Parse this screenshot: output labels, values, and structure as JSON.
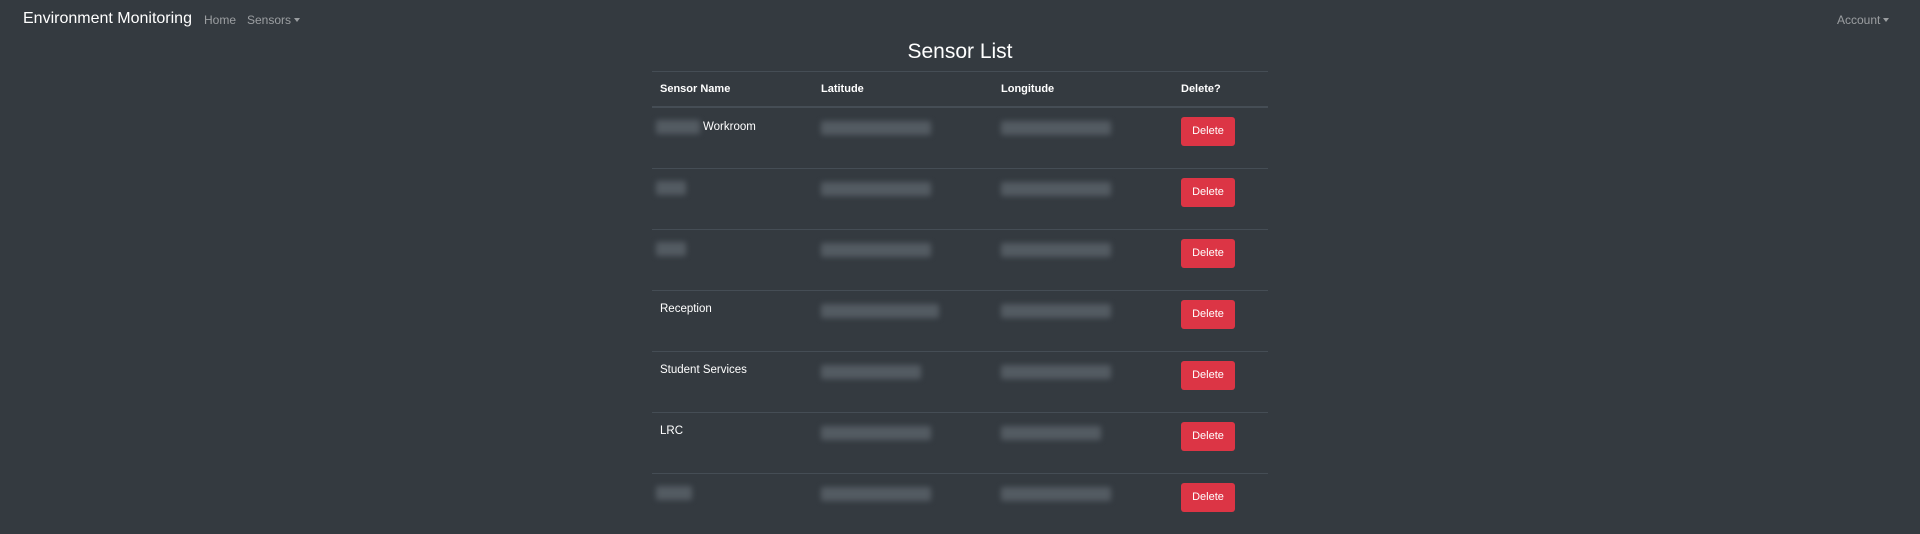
{
  "navbar": {
    "brand": "Environment Monitoring",
    "home_label": "Home",
    "sensors_label": "Sensors",
    "account_label": "Account"
  },
  "page": {
    "title": "Sensor List"
  },
  "table": {
    "headers": [
      "Sensor Name",
      "Latitude",
      "Longitude",
      "Delete?"
    ],
    "rows": [
      {
        "name": "Workroom",
        "name_redacted_prefix": true,
        "latitude_redacted": true,
        "longitude_redacted": true
      },
      {
        "name": "",
        "name_redacted_prefix": true,
        "latitude_redacted": true,
        "longitude_redacted": true
      },
      {
        "name": "",
        "name_redacted_prefix": true,
        "latitude_redacted": true,
        "longitude_redacted": true
      },
      {
        "name": "Reception",
        "name_redacted_prefix": false,
        "latitude_redacted": true,
        "longitude_redacted": true
      },
      {
        "name": "Student Services",
        "name_redacted_prefix": false,
        "latitude_redacted": true,
        "longitude_redacted": true
      },
      {
        "name": "LRC",
        "name_redacted_prefix": false,
        "latitude_redacted": true,
        "longitude_redacted": true
      },
      {
        "name": "",
        "name_redacted_prefix": true,
        "latitude_redacted": true,
        "longitude_redacted": true
      }
    ],
    "delete_label": "Delete"
  },
  "colors": {
    "background": "#343a40",
    "danger": "#dc3545",
    "border": "#454d55",
    "muted_link": "rgba(255,255,255,0.5)"
  }
}
